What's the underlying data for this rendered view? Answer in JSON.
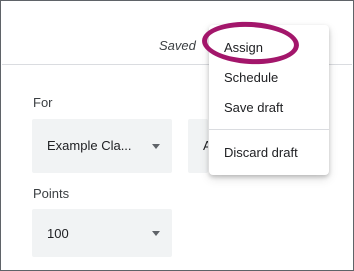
{
  "header": {
    "saved_status": "Saved"
  },
  "form": {
    "for_label": "For",
    "class_select_value": "Example Cla...",
    "secondary_select_value": "A",
    "points_label": "Points",
    "points_select_value": "100"
  },
  "assign_menu": {
    "items": [
      {
        "label": "Assign"
      },
      {
        "label": "Schedule"
      },
      {
        "label": "Save draft"
      },
      {
        "label": "Discard draft"
      }
    ]
  },
  "colors": {
    "highlight_ring": "#a3166b",
    "field_background": "#f1f3f4",
    "divider": "#dadce0"
  },
  "icons": {
    "dropdown": "caret-down-icon"
  }
}
